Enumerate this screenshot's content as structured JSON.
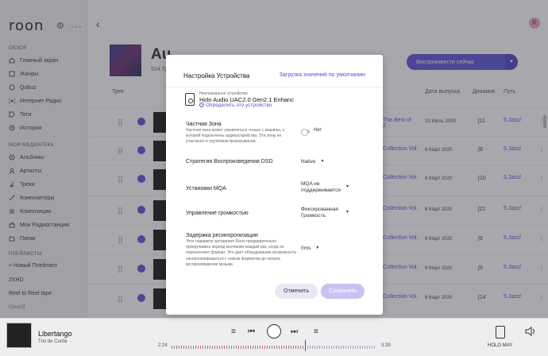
{
  "sidebar": {
    "logo": "roon",
    "section_overview": "ОБЗОР",
    "overview_items": [
      {
        "label": "Главный экран",
        "icon": "home-icon"
      },
      {
        "label": "Жанры",
        "icon": "genres-icon"
      },
      {
        "label": "Qobuz",
        "icon": "qobuz-icon"
      },
      {
        "label": "Интернет Радио",
        "icon": "radio-icon"
      },
      {
        "label": "Теги",
        "icon": "tag-icon"
      },
      {
        "label": "История",
        "icon": "history-icon"
      }
    ],
    "section_library": "МОЯ МЕДИАТЕКА",
    "library_items": [
      {
        "label": "Альбомы",
        "icon": "albums-icon"
      },
      {
        "label": "Артисты",
        "icon": "artists-icon"
      },
      {
        "label": "Треки",
        "icon": "tracks-icon"
      },
      {
        "label": "Композиторы",
        "icon": "composers-icon"
      },
      {
        "label": "Композиции",
        "icon": "compositions-icon"
      },
      {
        "label": "Мои Радиостанции",
        "icon": "my-radio-icon"
      },
      {
        "label": "Папки",
        "icon": "folder-icon"
      }
    ],
    "section_playlists": "ПЛЕЙЛИСТЫ",
    "new_playlist": "+ Новый Плейлист",
    "playlists": [
      "2XHD",
      "Reel to Reel tape",
      "Opus3"
    ]
  },
  "main": {
    "album_title": "Au",
    "album_sub": "524 Тр",
    "play_now": "Воспроизвести сейчас",
    "columns": {
      "track": "Трек",
      "date": "Дата выпуска",
      "dyn": "Динамик",
      "path": "Путь"
    },
    "rows": [
      {
        "track": "The Best of",
        "track2": "2",
        "date": "21 Июль 2009",
        "dyn": "11",
        "path": "5.Jazz/"
      },
      {
        "track": "Collection Vol.",
        "date": "6 Март 2020",
        "dyn": "8",
        "path": "5.Jazz/"
      },
      {
        "track": "Collection Vol.",
        "date": "6 Март 2020",
        "dyn": "10",
        "path": "5.Jazz/"
      },
      {
        "track": "Collection Vol.",
        "date": "6 Март 2020",
        "dyn": "21",
        "path": "5.Jazz/"
      },
      {
        "track": "Collection Vol.",
        "date": "6 Март 2020",
        "dyn": "9",
        "path": "5.Jazz/"
      },
      {
        "track": "Collection Vol.",
        "date": "6 Март 2020",
        "dyn": "9",
        "path": "5.Jazz/"
      },
      {
        "track": "Collection Vol.",
        "date": "6 Март 2020",
        "dyn": "14",
        "path": "5.Jazz/"
      }
    ]
  },
  "modal": {
    "title": "Настройка Устройства",
    "defaults_link": "Загрузка значений по умолчанию",
    "device_status": "Неопознанное устройство",
    "device_name": "Holo Audio UAC2.0 Gen2.1 Enhanc",
    "identify_link": "Определить это устройство",
    "private_zone_label": "Частная Зона",
    "private_zone_desc": "Частная зона может управляться только с машины, к которой подключены аудиоустройства. Эти зоны не участвуют в групповом проигрывании.",
    "private_zone_value": "Нет",
    "dsd_label": "Стратегия Воспроизведения DSD",
    "dsd_value": "Native",
    "mqa_label": "Установки MQA",
    "mqa_value_1": "MQA не",
    "mqa_value_2": "поддерживается",
    "volume_label": "Управление громкостью",
    "volume_value_1": "Фиксированная",
    "volume_value_2": "Громкость",
    "resync_label": "Задержка ресинхронизации",
    "resync_desc": "Этот параметр заставляет Roon предварительно прокручивать период молчания каждый раз, когда он переключает формат. Это дает оборудованию возможность синхронизироваться с новым форматом до начала воспроизведения музыки.",
    "resync_value": "0ms",
    "cancel": "Отменить",
    "save": "Сохранить"
  },
  "player": {
    "title": "Libertango",
    "artist": "Trio de Curda",
    "elapsed": "2:24",
    "duration": "3:39",
    "progress": 0.65,
    "zone": "HOLO MAY"
  },
  "colors": {
    "accent": "#5a4fd6",
    "save_disabled": "#c9c3f0"
  }
}
